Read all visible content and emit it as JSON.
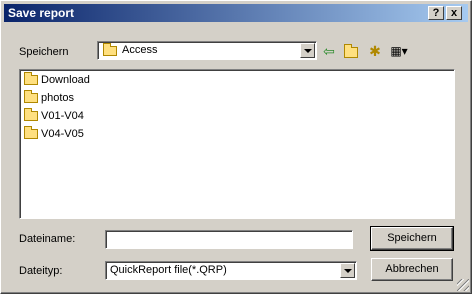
{
  "window": {
    "title": "Save report",
    "help_label": "?",
    "close_label": "x"
  },
  "location": {
    "label": "Speichern",
    "current_folder": "Access"
  },
  "toolbar": {
    "icons": [
      "back-arrow-icon",
      "up-folder-icon",
      "new-folder-icon",
      "view-menu-icon"
    ]
  },
  "files": [
    {
      "name": "Download"
    },
    {
      "name": "photos"
    },
    {
      "name": "V01-V04"
    },
    {
      "name": "V04-V05"
    }
  ],
  "filename": {
    "label": "Dateiname:",
    "value": ""
  },
  "filetype": {
    "label": "Dateityp:",
    "value": "QuickReport file(*.QRP)"
  },
  "buttons": {
    "save": "Speichern",
    "cancel": "Abbrechen"
  }
}
